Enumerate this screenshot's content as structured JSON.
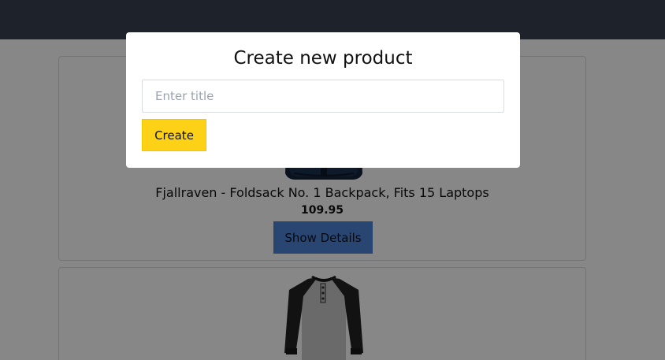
{
  "modal": {
    "title": "Create new product",
    "input_value": "",
    "input_placeholder": "Enter title",
    "create_label": "Create"
  },
  "products": [
    {
      "title": "Fjallraven - Foldsack No. 1 Backpack, Fits 15 Laptops",
      "price": "109.95",
      "details_label": "Show Details",
      "image_icon": "backpack-image"
    },
    {
      "image_icon": "raglan-shirt-image"
    }
  ],
  "colors": {
    "navbar": "#374151",
    "details_button": "#4f83d6",
    "create_button": "#fcd116",
    "overlay": "rgba(0,0,0,0.47)"
  }
}
